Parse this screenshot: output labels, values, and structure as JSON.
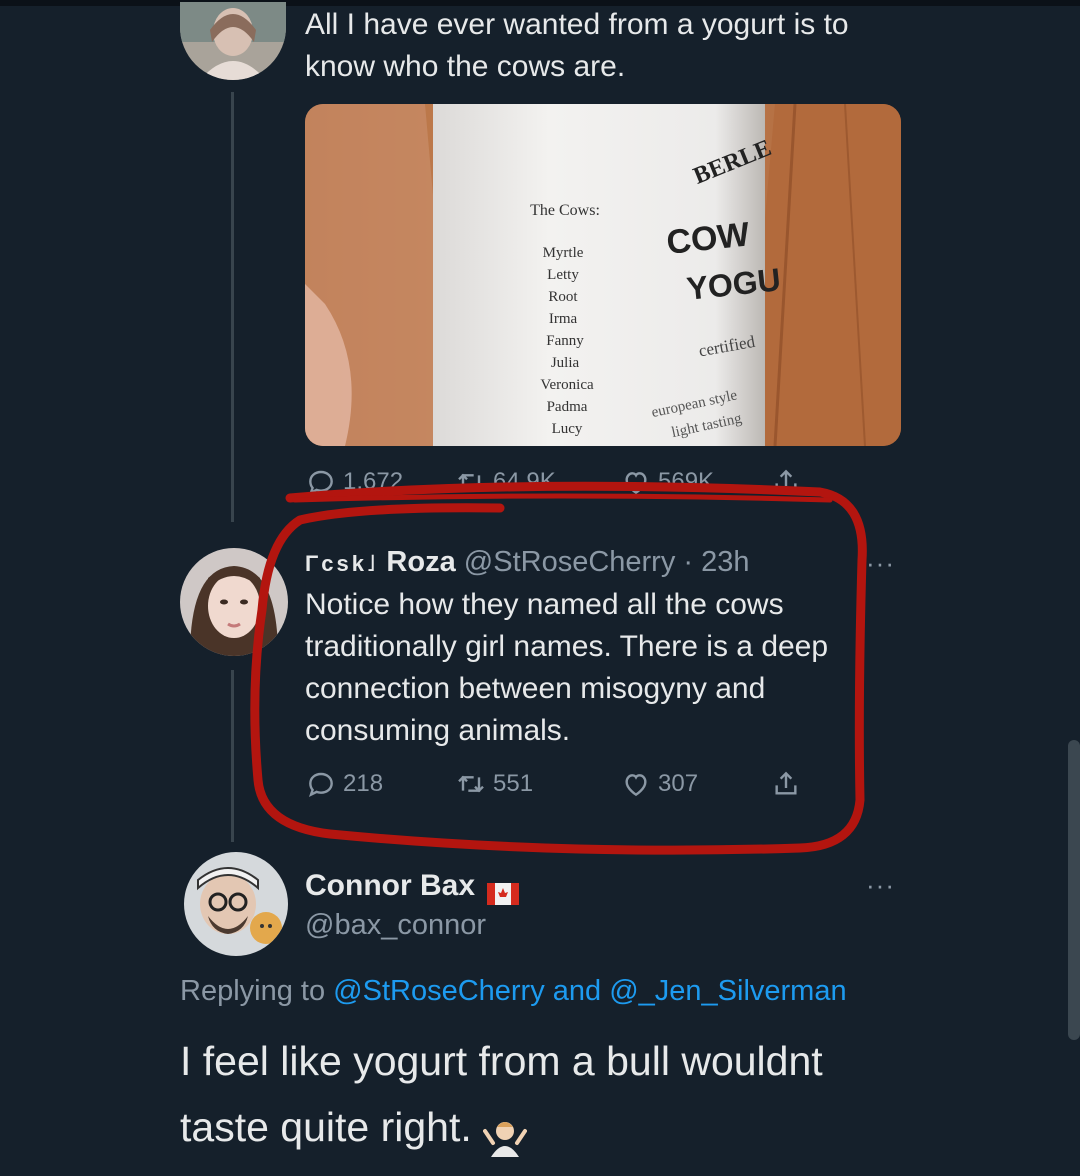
{
  "original_tweet": {
    "text_line1": "All I have ever wanted from a yogurt is to",
    "text_line2": "know who the cows are.",
    "photo": {
      "label_heading": "The Cows:",
      "cow_names": [
        "Myrtle",
        "Letty",
        "Root",
        "Irma",
        "Fanny",
        "Julia",
        "Veronica",
        "Padma",
        "Lucy"
      ],
      "brand_partial": "BERLE",
      "product_line1": "COW",
      "product_line2": "YOGU",
      "certified": "certified",
      "style_line1": "european style",
      "style_line2": "light tasting"
    },
    "stats": {
      "replies": "1,672",
      "retweets": "64.9K",
      "likes": "569K"
    }
  },
  "quoted_reply": {
    "prefix": "Γcsk˩",
    "display_name": "Roza",
    "handle_time": "@StRoseCherry · 23h",
    "more": "···",
    "text_lines": [
      "Notice how they named all the cows",
      "traditionally girl names. There is a deep",
      "connection between misogyny and",
      "consuming animals."
    ],
    "stats": {
      "replies": "218",
      "retweets": "551",
      "likes": "307"
    }
  },
  "bottom_reply": {
    "display_name": "Connor Bax",
    "handle": "@bax_connor",
    "more": "···",
    "replying_prefix": "Replying to ",
    "replying_user1": "@StRoseCherry",
    "replying_and": " and ",
    "replying_user2": "@_Jen_Silverman",
    "text_line1": "I feel like yogurt from a bull wouldnt",
    "text_line2": "taste quite right. "
  },
  "colors": {
    "background": "#15202b",
    "text": "#e7e9ea",
    "muted": "#8b98a5",
    "link": "#1d9bf0",
    "annotation_red": "#b3150f"
  },
  "icons": [
    "reply-icon",
    "retweet-icon",
    "like-icon",
    "share-icon",
    "canada-flag-icon",
    "shrug-emoji"
  ]
}
